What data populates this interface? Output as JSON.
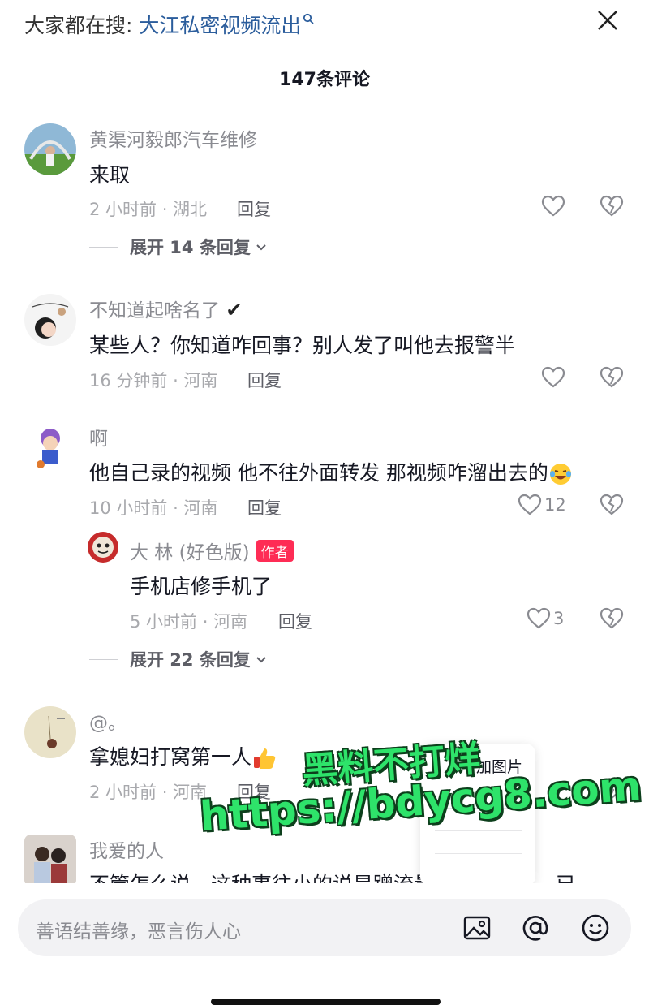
{
  "header": {
    "search_prefix": "大家都在搜: ",
    "search_query": "大江私密视频流出",
    "comment_count": "147条评论"
  },
  "comments": [
    {
      "username": "黄渠河毅郎汽车维修",
      "text": "来取",
      "time_location": "2 小时前 · 湖北",
      "reply_label": "回复",
      "expand_label": "展开 14 条回复"
    },
    {
      "username": "不知道起啥名了",
      "username_suffix": "✔",
      "text": "某些人？你知道咋回事？别人发了叫他去报警半",
      "time_location": "16 分钟前 · 河南",
      "reply_label": "回复"
    },
    {
      "username": "啊",
      "text": "他自己录的视频 他不往外面转发 那视频咋溜出去的",
      "time_location": "10 小时前 · 河南",
      "reply_label": "回复",
      "like_count": "12",
      "reply": {
        "username": "大 林 (好色版)",
        "badge": "作者",
        "text": "手机店修手机了",
        "time_location": "5 小时前 · 河南",
        "reply_label": "回复",
        "like_count": "3"
      },
      "expand_label": "展开 22 条回复"
    },
    {
      "username": "@。",
      "text": "拿媳妇打窝第一人",
      "time_location": "2 小时前 · 河南",
      "reply_label": "回复"
    },
    {
      "username": "我爱的人",
      "text": "不管怎么说，这种事往小的说是蹭流量，往大了说，已"
    }
  ],
  "popup": {
    "label": "加图片"
  },
  "input": {
    "placeholder": "善语结善缘，恶言伤人心"
  },
  "watermark": {
    "line1": "黑料不打烊",
    "line2": "https://bdycg8.com"
  },
  "colors": {
    "accent": "#fe2c55",
    "link": "#2b5d9c",
    "watermark": "#2ee36a"
  },
  "icons": [
    "search-icon",
    "close-icon",
    "heart-icon",
    "broken-heart-icon",
    "chevron-down-icon",
    "image-icon",
    "at-icon",
    "emoji-icon"
  ]
}
